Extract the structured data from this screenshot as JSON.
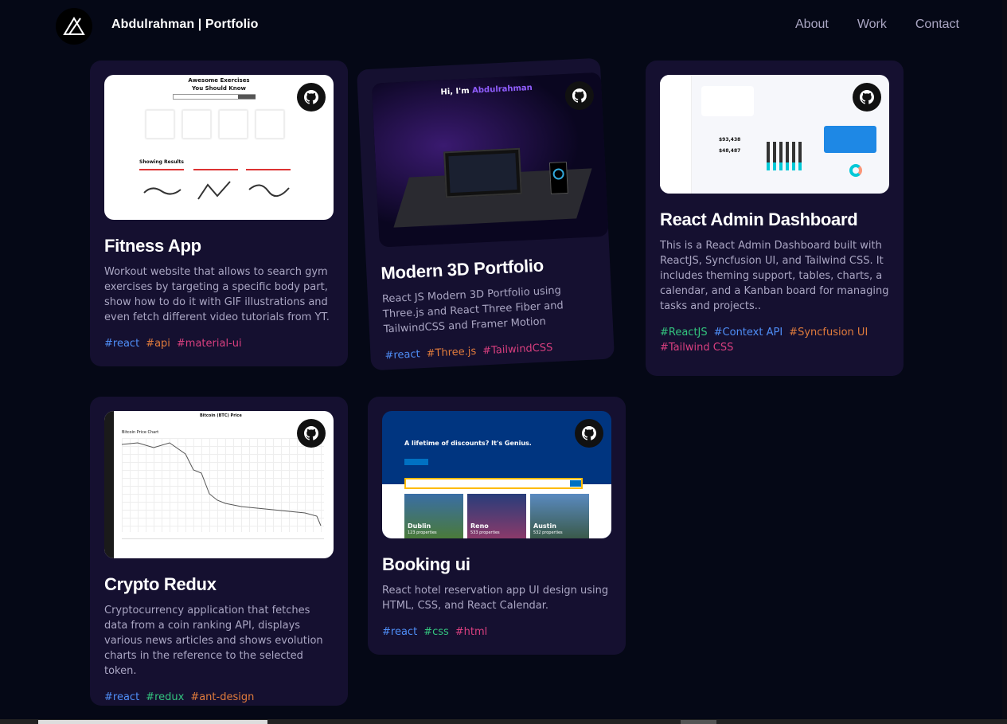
{
  "nav": {
    "brand": "Abdulrahman | Portfolio",
    "links": [
      "About",
      "Work",
      "Contact"
    ]
  },
  "colors": {
    "blue": "#4f8ef7",
    "orange": "#e07b3c",
    "pink": "#d93f7f",
    "green": "#33c47e"
  },
  "projects": [
    {
      "title": "Fitness App",
      "description": "Workout website that allows to search gym exercises by targeting a specific body part, show how to do it with GIF illustrations and even fetch different video tutorials from YT.",
      "tags": [
        "#react",
        "#api",
        "#material-ui"
      ],
      "preview": {
        "heading": "Awesome Exercises You Should Know",
        "results": "Showing Results"
      }
    },
    {
      "title": "Modern 3D Portfolio",
      "description": "React JS Modern 3D Portfolio using Three.js and React Three Fiber and TailwindCSS and Framer Motion",
      "tags": [
        "#react",
        "#Three.js",
        "#TailwindCSS"
      ],
      "preview": {
        "greeting": "Hi, I'm ",
        "name": "Abdulrahman"
      }
    },
    {
      "title": "React Admin Dashboard",
      "description": "This is a React Admin Dashboard built with ReactJS, Syncfusion UI, and Tailwind CSS. It includes theming support, tables, charts, a calendar, and a Kanban board for managing tasks and projects..",
      "tags": [
        "#ReactJS",
        "#Context API",
        "#Syncfusion UI",
        "#Tailwind CSS"
      ],
      "preview": {
        "stat1": "$93,438",
        "stat2": "$48,487"
      }
    },
    {
      "title": "Crypto Redux",
      "description": "Cryptocurrency application that fetches data from a coin ranking API, displays various news articles and shows evolution charts in the reference to the selected token.",
      "tags": [
        "#react",
        "#redux",
        "#ant-design"
      ],
      "preview": {
        "heading": "Bitcoin (BTC) Price",
        "chart": "Bitcoin Price Chart"
      }
    },
    {
      "title": "Booking ui",
      "description": "React hotel reservation app UI design using HTML, CSS, and React Calendar.",
      "tags": [
        "#react",
        "#css",
        "#html"
      ],
      "preview": {
        "headline": "A lifetime of discounts? It's Genius.",
        "cities": [
          {
            "name": "Dublin",
            "count": "123 properties"
          },
          {
            "name": "Reno",
            "count": "533 properties"
          },
          {
            "name": "Austin",
            "count": "532 properties"
          }
        ]
      }
    }
  ]
}
